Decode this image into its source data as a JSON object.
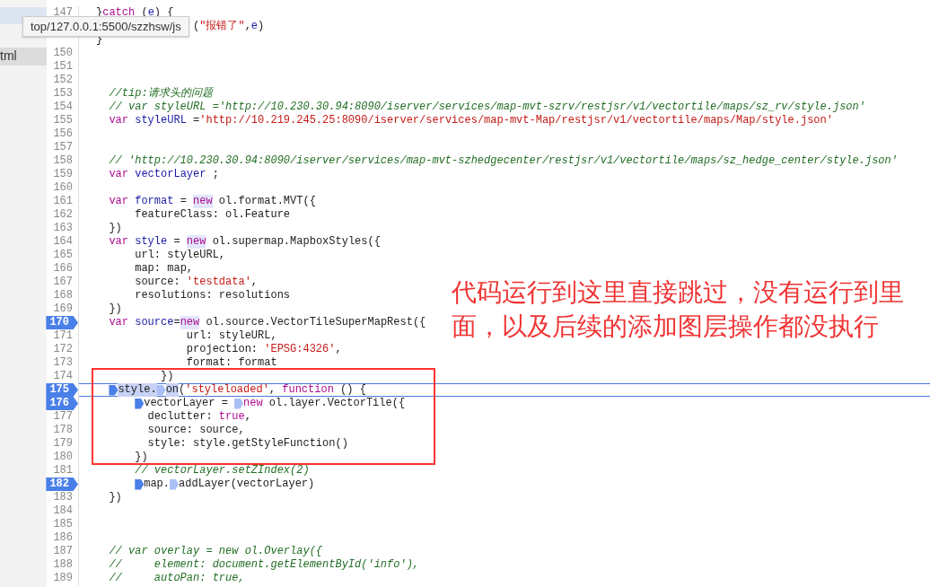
{
  "sidebar": {
    "items": [
      {
        "selected": true,
        "hovered": false
      },
      {
        "label": "tml",
        "selected": false,
        "hovered": true
      }
    ]
  },
  "tooltip": "top/127.0.0.1:5500/szzhsw/js",
  "lines": [
    {
      "num": "147",
      "breakpoint": false,
      "current": false,
      "tokens": [
        {
          "t": "}",
          "kind": "plain"
        },
        {
          "t": "catch",
          "kind": "kw"
        },
        {
          "t": " (",
          "kind": "plain"
        },
        {
          "t": "e",
          "kind": "def"
        },
        {
          "t": ") {",
          "kind": "plain"
        }
      ]
    },
    {
      "tokens": [
        {
          "t": "               (",
          "kind": "plain"
        },
        {
          "t": "\"报错了\"",
          "kind": "str"
        },
        {
          "t": ",",
          "kind": "plain"
        },
        {
          "t": "e",
          "kind": "def"
        },
        {
          "t": ")",
          "kind": "plain"
        }
      ]
    },
    {
      "tokens": [
        {
          "t": "}",
          "kind": "plain"
        }
      ]
    },
    {
      "num": "150",
      "breakpoint": false,
      "current": false
    },
    {
      "num": "151",
      "breakpoint": false,
      "current": false
    },
    {
      "num": "152",
      "breakpoint": false,
      "current": false
    },
    {
      "num": "153",
      "breakpoint": false,
      "current": false,
      "tokens": [
        {
          "t": "  //tip:请求头的问题",
          "kind": "com"
        }
      ]
    },
    {
      "num": "154",
      "breakpoint": false,
      "current": false,
      "tokens": [
        {
          "t": "  // var styleURL ='http://10.230.30.94:8090/iserver/services/map-mvt-szrv/restjsr/v1/vectortile/maps/sz_rv/style.json'",
          "kind": "com"
        }
      ]
    },
    {
      "num": "155",
      "breakpoint": false,
      "current": false,
      "tokens": [
        {
          "t": "  var",
          "kind": "kw"
        },
        {
          "t": " styleURL",
          "kind": "def"
        },
        {
          "t": " =",
          "kind": "plain"
        },
        {
          "t": "'http://10.219.245.25:8090/iserver/services/map-mvt-Map/restjsr/v1/vectortile/maps/Map/style.json'",
          "kind": "str"
        }
      ]
    },
    {
      "num": "156",
      "breakpoint": false,
      "current": false
    },
    {
      "num": "157",
      "breakpoint": false,
      "current": false
    },
    {
      "num": "158",
      "breakpoint": false,
      "current": false,
      "tokens": [
        {
          "t": "  // 'http://10.230.30.94:8090/iserver/services/map-mvt-szhedgecenter/restjsr/v1/vectortile/maps/sz_hedge_center/style.json'",
          "kind": "com"
        }
      ]
    },
    {
      "num": "159",
      "breakpoint": false,
      "current": false,
      "tokens": [
        {
          "t": "  var",
          "kind": "kw"
        },
        {
          "t": " vectorLayer",
          "kind": "def"
        },
        {
          "t": " ;",
          "kind": "plain"
        }
      ]
    },
    {
      "num": "160",
      "breakpoint": false,
      "current": false
    },
    {
      "num": "161",
      "breakpoint": false,
      "current": false,
      "tokens": [
        {
          "t": "  var",
          "kind": "kw"
        },
        {
          "t": " format",
          "kind": "def"
        },
        {
          "t": " =",
          "kind": "plain"
        },
        {
          "t": " new",
          "kind": "kw-hl"
        },
        {
          "t": " ol.format.MVT({",
          "kind": "plain"
        }
      ]
    },
    {
      "num": "162",
      "breakpoint": false,
      "current": false,
      "tokens": [
        {
          "t": "      featureClass: ol.Feature",
          "kind": "plain"
        }
      ]
    },
    {
      "num": "163",
      "breakpoint": false,
      "current": false,
      "tokens": [
        {
          "t": "  })",
          "kind": "plain"
        }
      ]
    },
    {
      "num": "164",
      "breakpoint": false,
      "current": false,
      "tokens": [
        {
          "t": "  var",
          "kind": "kw"
        },
        {
          "t": " style",
          "kind": "def"
        },
        {
          "t": " =",
          "kind": "plain"
        },
        {
          "t": " new",
          "kind": "kw-hl"
        },
        {
          "t": " ol.supermap.MapboxStyles({",
          "kind": "plain"
        }
      ]
    },
    {
      "num": "165",
      "breakpoint": false,
      "current": false,
      "tokens": [
        {
          "t": "      url: styleURL,",
          "kind": "plain"
        }
      ]
    },
    {
      "num": "166",
      "breakpoint": false,
      "current": false,
      "tokens": [
        {
          "t": "      map: map,",
          "kind": "plain"
        }
      ]
    },
    {
      "num": "167",
      "breakpoint": false,
      "current": false,
      "tokens": [
        {
          "t": "      source:",
          "kind": "plain"
        },
        {
          "t": " 'testdata'",
          "kind": "str"
        },
        {
          "t": ",",
          "kind": "plain"
        }
      ]
    },
    {
      "num": "168",
      "breakpoint": false,
      "current": false,
      "tokens": [
        {
          "t": "      resolutions: resolutions",
          "kind": "plain"
        }
      ]
    },
    {
      "num": "169",
      "breakpoint": false,
      "current": false,
      "tokens": [
        {
          "t": "  })",
          "kind": "plain"
        }
      ]
    },
    {
      "num": "170",
      "breakpoint": true,
      "current": false,
      "tokens": [
        {
          "t": "  var",
          "kind": "kw"
        },
        {
          "t": " source",
          "kind": "def"
        },
        {
          "t": "=",
          "kind": "plain"
        },
        {
          "t": "new",
          "kind": "kw-hl"
        },
        {
          "t": " ol.source.VectorTileSuperMapRest({",
          "kind": "plain"
        }
      ]
    },
    {
      "num": "171",
      "breakpoint": false,
      "current": false,
      "tokens": [
        {
          "t": "              url: styleURL,",
          "kind": "plain"
        }
      ]
    },
    {
      "num": "172",
      "breakpoint": false,
      "current": false,
      "tokens": [
        {
          "t": "              projection:",
          "kind": "plain"
        },
        {
          "t": " 'EPSG:4326'",
          "kind": "str"
        },
        {
          "t": ",",
          "kind": "plain"
        }
      ]
    },
    {
      "num": "173",
      "breakpoint": false,
      "current": false,
      "tokens": [
        {
          "t": "              format: format",
          "kind": "plain"
        }
      ]
    },
    {
      "num": "174",
      "breakpoint": false,
      "current": false,
      "tokens": [
        {
          "t": "          })",
          "kind": "plain"
        }
      ]
    },
    {
      "num": "175",
      "breakpoint": true,
      "current": true,
      "tokens": [
        {
          "t": "  style.",
          "kind": "plain-hl",
          "marker_active": true
        },
        {
          "t": "on",
          "kind": "plain-hl",
          "marker_active": false
        },
        {
          "t": "(",
          "kind": "plain"
        },
        {
          "t": "'styleloaded'",
          "kind": "str"
        },
        {
          "t": ",",
          "kind": "plain"
        },
        {
          "t": " function",
          "kind": "kw"
        },
        {
          "t": " () {",
          "kind": "plain"
        }
      ]
    },
    {
      "num": "176",
      "breakpoint": true,
      "current": false,
      "tokens": [
        {
          "t": "      vectorLayer =",
          "kind": "plain",
          "marker_active": true
        },
        {
          "t": " new",
          "kind": "kw",
          "marker_active": false
        },
        {
          "t": " ol.layer.VectorTile({",
          "kind": "plain"
        }
      ]
    },
    {
      "num": "177",
      "breakpoint": false,
      "current": false,
      "tokens": [
        {
          "t": "        declutter:",
          "kind": "plain"
        },
        {
          "t": " true",
          "kind": "kw"
        },
        {
          "t": ",",
          "kind": "plain"
        }
      ]
    },
    {
      "num": "178",
      "breakpoint": false,
      "current": false,
      "tokens": [
        {
          "t": "        source: source,",
          "kind": "plain"
        }
      ]
    },
    {
      "num": "179",
      "breakpoint": false,
      "current": false,
      "tokens": [
        {
          "t": "        style: style.getStyleFunction()",
          "kind": "plain"
        }
      ]
    },
    {
      "num": "180",
      "breakpoint": false,
      "current": false,
      "tokens": [
        {
          "t": "      })",
          "kind": "plain"
        }
      ]
    },
    {
      "num": "181",
      "breakpoint": false,
      "current": false,
      "tokens": [
        {
          "t": "      // vectorLayer.setZIndex(2)",
          "kind": "com"
        }
      ]
    },
    {
      "num": "182",
      "breakpoint": true,
      "current": false,
      "tokens": [
        {
          "t": "      map.",
          "kind": "plain",
          "marker_active": true
        },
        {
          "t": "addLayer(vectorLayer)",
          "kind": "plain",
          "marker_active": false
        }
      ]
    },
    {
      "num": "183",
      "breakpoint": false,
      "current": false,
      "tokens": [
        {
          "t": "  })",
          "kind": "plain"
        }
      ]
    },
    {
      "num": "184",
      "breakpoint": false,
      "current": false
    },
    {
      "num": "185",
      "breakpoint": false,
      "current": false
    },
    {
      "num": "186",
      "breakpoint": false,
      "current": false
    },
    {
      "num": "187",
      "breakpoint": false,
      "current": false,
      "tokens": [
        {
          "t": "  // var overlay = new ol.Overlay({",
          "kind": "com"
        }
      ]
    },
    {
      "num": "188",
      "breakpoint": false,
      "current": false,
      "tokens": [
        {
          "t": "  //     element: document.getElementById('info'),",
          "kind": "com"
        }
      ]
    },
    {
      "num": "189",
      "breakpoint": false,
      "current": false,
      "tokens": [
        {
          "t": "  //     autoPan: true,",
          "kind": "com"
        }
      ]
    }
  ],
  "annotation": "代码运行到这里直接跳过，没有运行到里面，以及后续的添加图层操作都没执行"
}
